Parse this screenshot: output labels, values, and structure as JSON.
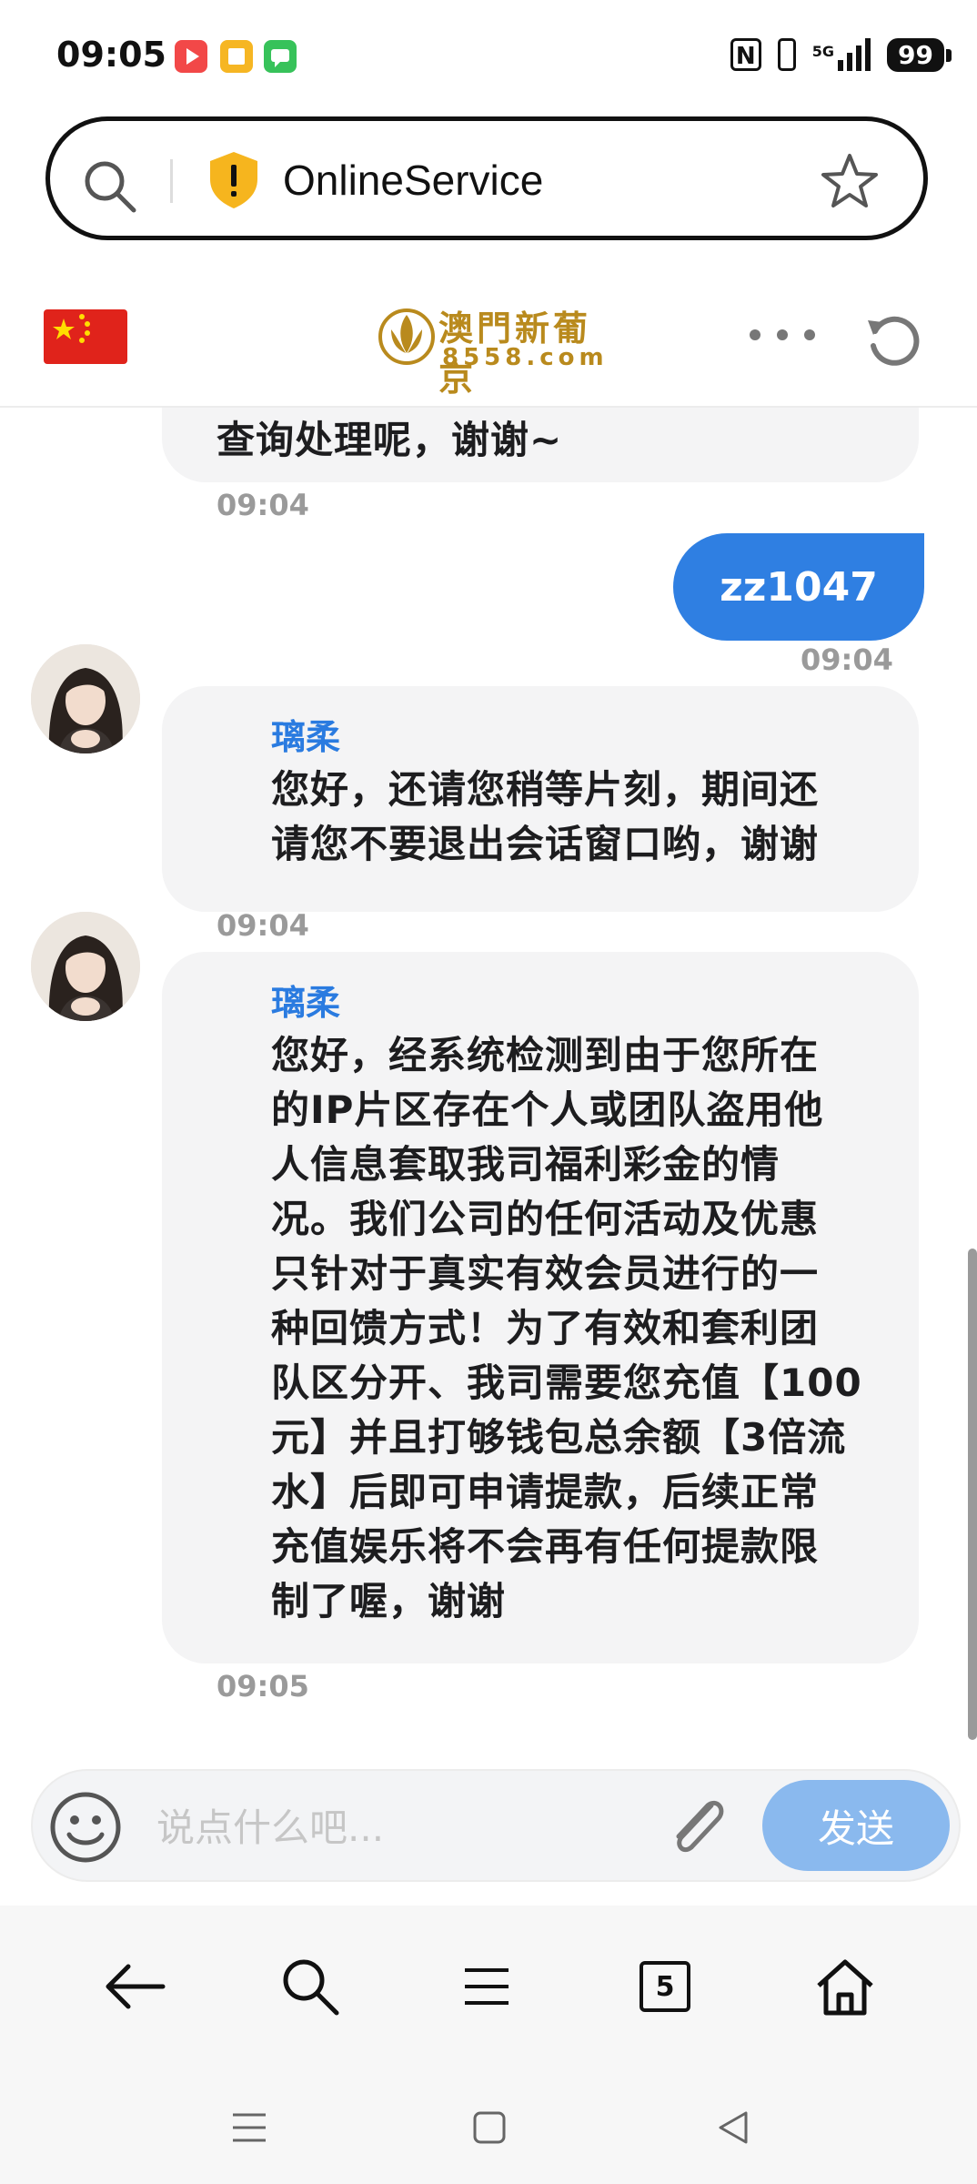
{
  "status_bar": {
    "time": "09:05",
    "network": "5G",
    "battery": "99",
    "app_icon_colors": [
      "#f24848",
      "#f6b623",
      "#37c25a"
    ]
  },
  "url_bar": {
    "title": "OnlineService"
  },
  "site_header": {
    "logo_text": "澳門新葡京",
    "logo_url": "8558.com"
  },
  "chat": {
    "messages": [
      {
        "from": "agent",
        "sender": "",
        "text": "查询处理呢，谢谢~",
        "time": "09:04"
      },
      {
        "from": "user",
        "text": "zz1047",
        "time": "09:04"
      },
      {
        "from": "agent",
        "sender": "璃柔",
        "lines": [
          "您好，还请您稍等片刻，期间还",
          "请您不要退出会话窗口哟，谢谢"
        ],
        "time": "09:04"
      },
      {
        "from": "agent",
        "sender": "璃柔",
        "lines": [
          "您好，经系统检测到由于您所在",
          "的IP片区存在个人或团队盗用他",
          "人信息套取我司福利彩金的情",
          "况。我们公司的任何活动及优惠",
          "只针对于真实有效会员进行的一",
          "种回馈方式！为了有效和套利团",
          "队区分开、我司需要您充值【100",
          "元】并且打够钱包总余额【3倍流",
          "水】后即可申请提款，后续正常",
          "充值娱乐将不会再有任何提款限",
          "制了喔，谢谢"
        ],
        "time": "09:05"
      }
    ]
  },
  "input": {
    "placeholder": "说点什么吧...",
    "send_label": "发送"
  },
  "bottom_nav": {
    "tabs_count": "5"
  },
  "colors": {
    "accent": "#2f7fe2",
    "send_button": "#8ab9ee",
    "bubble": "#f4f4f5",
    "sender_name": "#2a7be0"
  }
}
